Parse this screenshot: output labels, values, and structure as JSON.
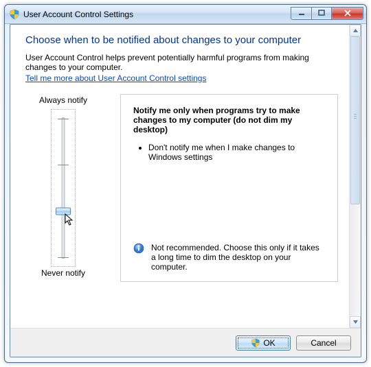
{
  "window": {
    "title": "User Account Control Settings"
  },
  "heading": "Choose when to be notified about changes to your computer",
  "intro": "User Account Control helps prevent potentially harmful programs from making changes to your computer.",
  "help_link": "Tell me more about User Account Control settings",
  "slider": {
    "top_label": "Always notify",
    "bottom_label": "Never notify",
    "levels": 4,
    "current_level_index": 2
  },
  "description": {
    "title": "Notify me only when programs try to make changes to my computer (do not dim my desktop)",
    "bullets": [
      "Don't notify me when I make changes to Windows settings"
    ],
    "note": "Not recommended. Choose this only if it takes a long time to dim the desktop on your computer."
  },
  "buttons": {
    "ok": "OK",
    "cancel": "Cancel"
  },
  "icons": {
    "shield": "uac-shield-icon",
    "info": "info-icon",
    "minimize": "minimize-icon",
    "maximize": "maximize-icon",
    "close": "close-icon",
    "cursor": "cursor-arrow-icon",
    "scroll_up": "scroll-up-icon",
    "scroll_down": "scroll-down-icon"
  }
}
